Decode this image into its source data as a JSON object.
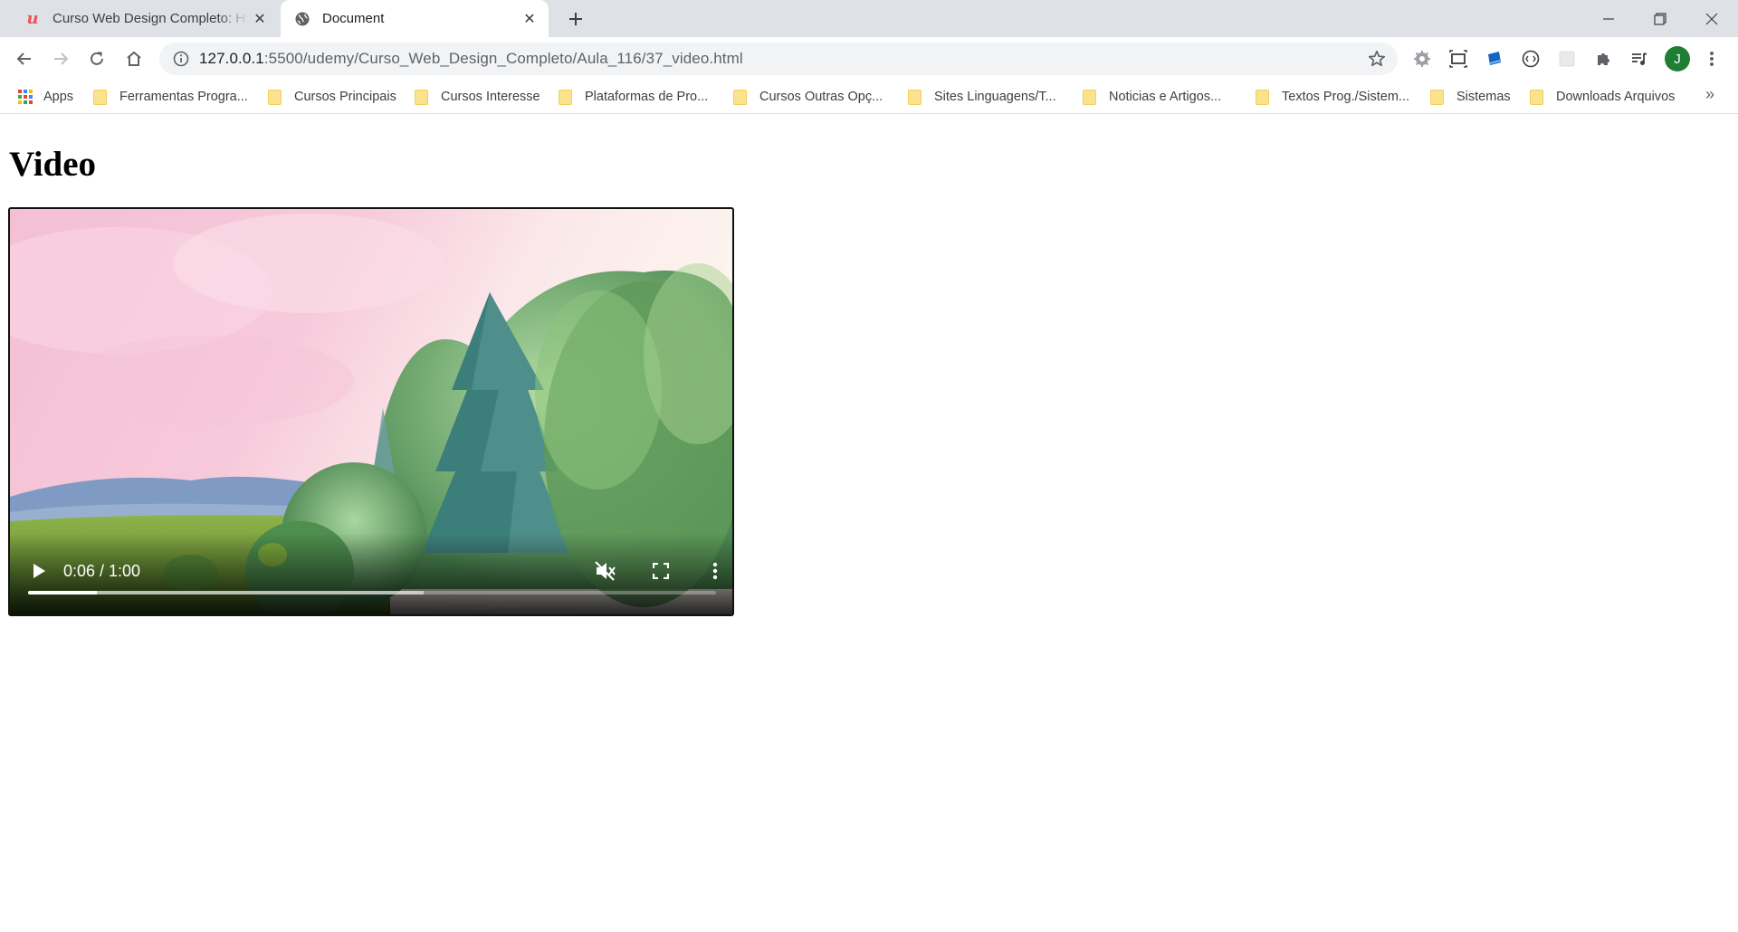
{
  "browser": {
    "tabs": [
      {
        "title": "Curso Web Design Completo: HTML",
        "active": false,
        "icon": "udemy-icon"
      },
      {
        "title": "Document",
        "active": true,
        "icon": "globe-icon"
      }
    ],
    "address": {
      "host": "127.0.0.1",
      "path": ":5500/udemy/Curso_Web_Design_Completo/Aula_116/37_video.html"
    },
    "profile_initial": "J",
    "bookmarks": [
      {
        "label": "Apps",
        "icon": "apps-grid-icon"
      },
      {
        "label": "Ferramentas Progra...",
        "icon": "folder-icon"
      },
      {
        "label": "Cursos Principais",
        "icon": "folder-icon"
      },
      {
        "label": "Cursos Interesse",
        "icon": "folder-icon"
      },
      {
        "label": "Plataformas de Pro...",
        "icon": "folder-icon"
      },
      {
        "label": "Cursos Outras Opç...",
        "icon": "folder-icon"
      },
      {
        "label": "Sites Linguagens/T...",
        "icon": "folder-icon"
      },
      {
        "label": "Noticias e Artigos...",
        "icon": "folder-icon"
      },
      {
        "label": "Textos Prog./Sistem...",
        "icon": "folder-icon"
      },
      {
        "label": "Sistemas",
        "icon": "folder-icon"
      },
      {
        "label": "Downloads Arquivos",
        "icon": "folder-icon"
      }
    ],
    "bookmarks_overflow": "»"
  },
  "page": {
    "heading": "Video",
    "video": {
      "time_display": "0:06 / 1:00",
      "played_fraction": 0.1,
      "buffered_fraction": 0.575,
      "muted": true
    }
  },
  "colors": {
    "tabstrip": "#dee1e6",
    "omnibox": "#f1f3f4",
    "avatar": "#1e7e34",
    "udemy": "#ec5252",
    "folder": "#fbe38e"
  }
}
